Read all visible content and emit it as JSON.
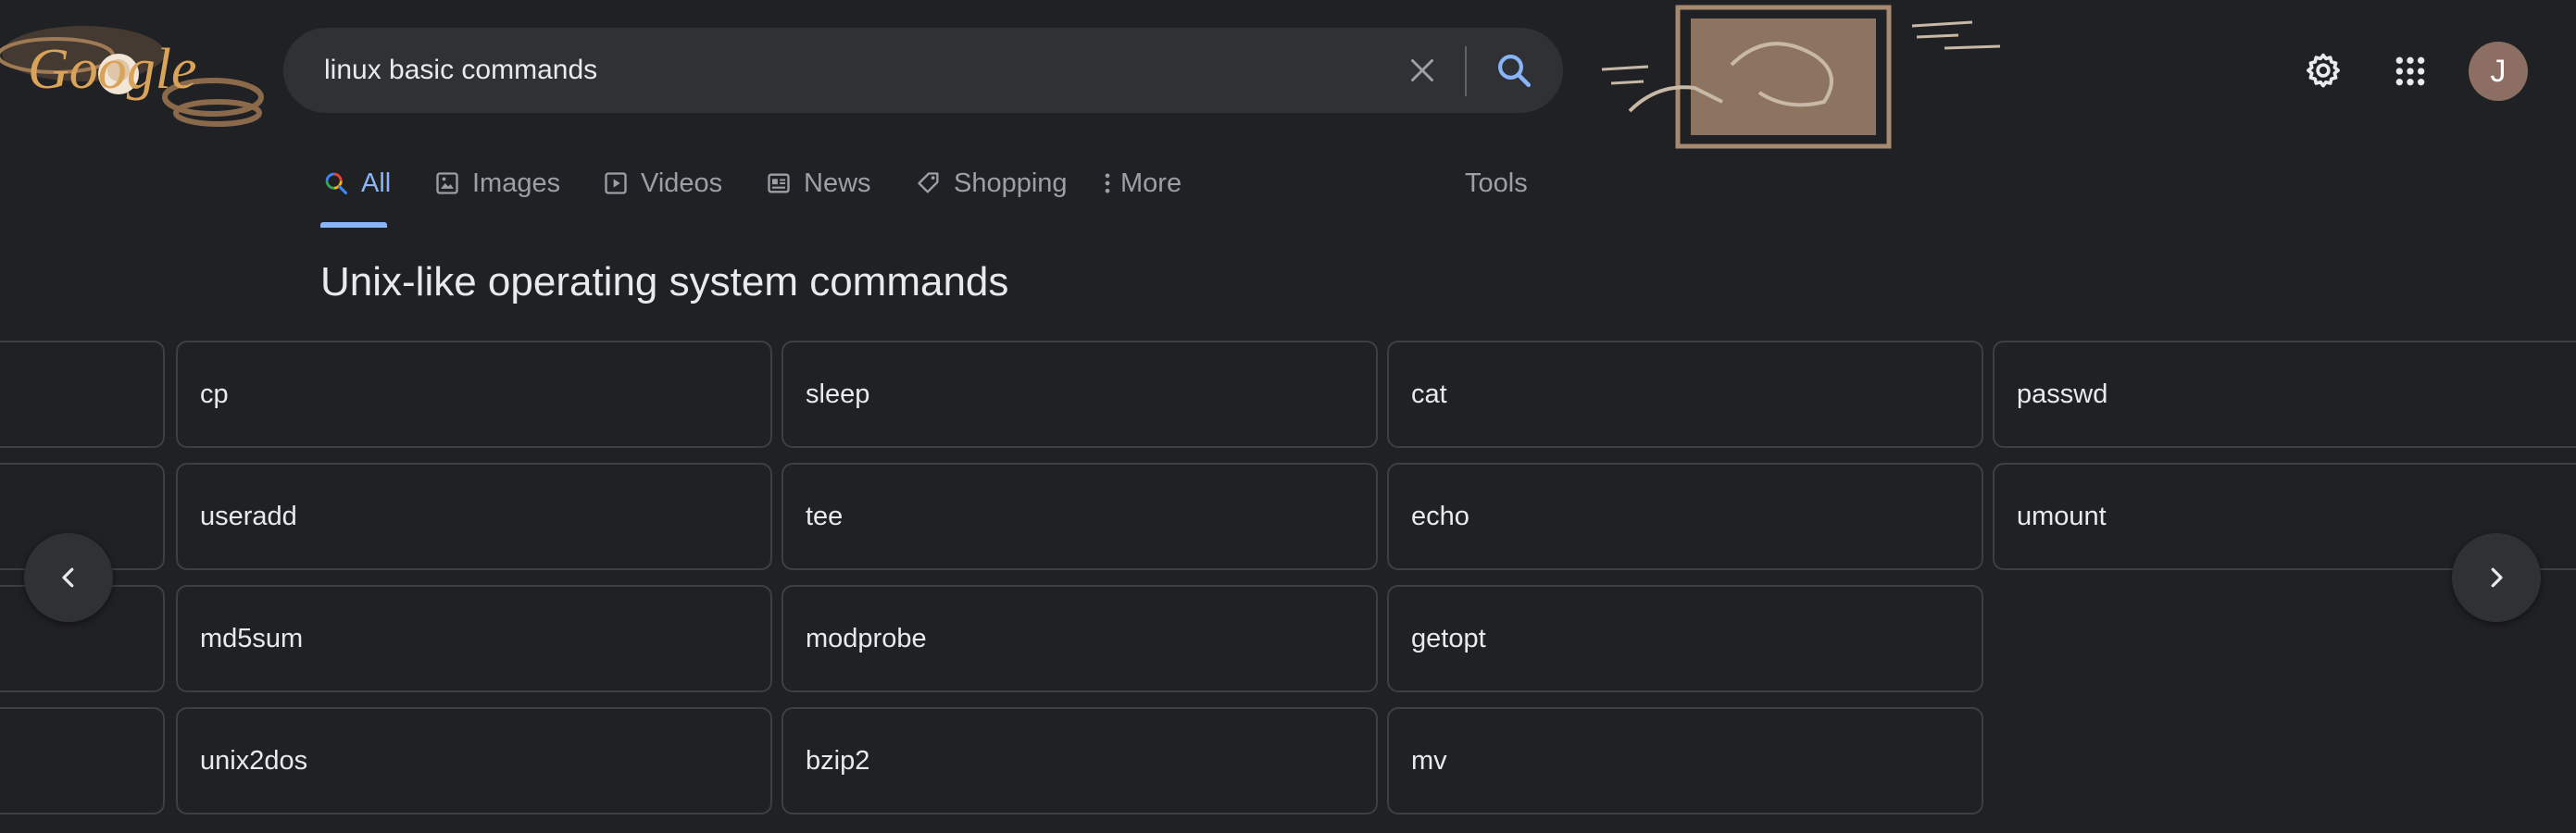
{
  "logo": {
    "text": "Google"
  },
  "search": {
    "query": "linux basic commands",
    "placeholder": ""
  },
  "header": {
    "avatar_initial": "J"
  },
  "tabs": [
    {
      "label": "All",
      "icon": "search-multicolor-icon",
      "active": true
    },
    {
      "label": "Images",
      "icon": "image-icon"
    },
    {
      "label": "Videos",
      "icon": "play-icon"
    },
    {
      "label": "News",
      "icon": "newspaper-icon"
    },
    {
      "label": "Shopping",
      "icon": "tag-icon"
    },
    {
      "label": "More",
      "icon": "more-vertical-icon"
    },
    {
      "label": "Tools"
    }
  ],
  "section": {
    "heading": "Unix-like operating system commands",
    "grid": [
      [
        "",
        "cp",
        "sleep",
        "cat",
        "passwd"
      ],
      [
        "",
        "useradd",
        "tee",
        "echo",
        "umount"
      ],
      [
        "",
        "md5sum",
        "modprobe",
        "getopt"
      ],
      [
        "",
        "unix2dos",
        "bzip2",
        "mv"
      ]
    ]
  },
  "colors": {
    "background": "#202124",
    "surface": "#303134",
    "border": "#3c4043",
    "accent": "#8ab4f8",
    "text": "#e8eaed",
    "muted": "#9aa0a6",
    "avatar": "#8d6e63"
  }
}
